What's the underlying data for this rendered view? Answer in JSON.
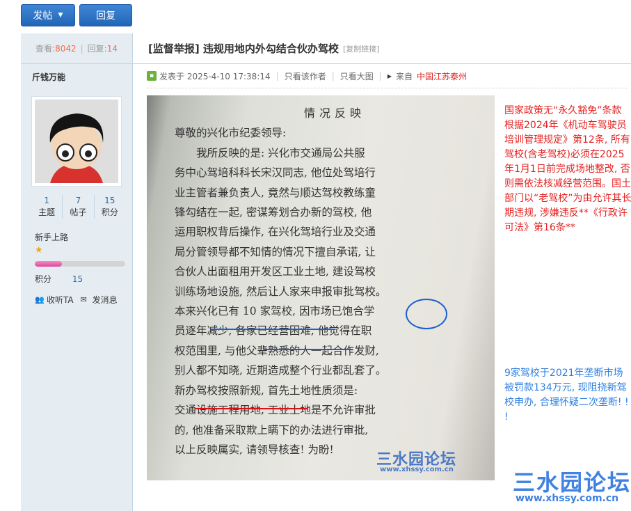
{
  "toolbar": {
    "post_label": "发帖",
    "reply_label": "回复"
  },
  "thread_stats": {
    "views_label": "查看:",
    "views": "8042",
    "replies_label": "回复:",
    "replies": "14"
  },
  "author": {
    "name": "斤钱万能",
    "counts": [
      {
        "value": "1",
        "label": "主题"
      },
      {
        "value": "7",
        "label": "帖子"
      },
      {
        "value": "15",
        "label": "积分"
      }
    ],
    "level": "新手上路",
    "progress": 0.3,
    "credits_label": "积分",
    "credits_value": "15",
    "follow_label": "收听TA",
    "message_label": "发消息"
  },
  "post": {
    "title": "[监督举报] 违规用地内外勾结合伙办驾校",
    "copy_link": "[复制链接]",
    "posted_at": "发表于 2025-4-10 17:38:14",
    "author_only": "只看该作者",
    "big_image": "只看大图",
    "from_label": "来自",
    "location": "中国江苏泰州"
  },
  "document": {
    "title": "情况反映",
    "lines": [
      "尊敬的兴化市纪委领导:",
      "　　我所反映的是: 兴化市交通局公共服",
      "务中心驾培科科长宋汉同志, 他位处驾培行",
      "业主管者兼负责人, 竟然与顺达驾校教练童",
      "锋勾结在一起, 密谋筹划合办新的驾校, 他",
      "运用职权背后操作, 在兴化驾培行业及交通",
      "局分管领导都不知情的情况下擅自承诺, 让",
      "合伙人出面租用开发区工业土地, 建设驾校",
      "训练场地设施, 然后让人家来申报审批驾校。",
      "本来兴化已有 10 家驾校, 因市场已饱合学",
      "员逐年减少, 各家已经营困难, 他觉得在职",
      "权范围里, 与他父辈熟悉的人一起合作发财,",
      "别人都不知晓, 近期造成整个行业都乱套了。",
      "新办驾校按照新规, 首先土地性质须是:",
      "交通设施工程用地, 工业土地是不允许审批",
      "的, 他准备采取欺上瞒下的办法进行审批,",
      "以上反映属实, 请领导核查! 为盼!"
    ],
    "watermark": "三水园论坛",
    "watermark_url": "www.xhssy.com.cn"
  },
  "annotation_red": "国家政策无“永久豁免”条款\n根据2024年《机动车驾驶员培训管理规定》第12条, 所有驾校(含老驾校)必须在2025年1月1日前完成场地整改, 否则需依法核减经营范围。国土部门以“老驾校”为由允许其长期违规, 涉嫌违反**《行政许可法》第16条**",
  "annotation_blue": "9家驾校于2021年垄断市场被罚款134万元, 现阻挠新驾校申办, 合理怀疑二次垄断! ! !",
  "site_watermark": "三水园论坛",
  "site_watermark_url": "www.xhssy.com.cn",
  "colors": {
    "accent": "#2265b8",
    "red_text": "#e62020",
    "blue_text": "#2d7fe0",
    "sidebar_bg": "#e5edf2"
  }
}
